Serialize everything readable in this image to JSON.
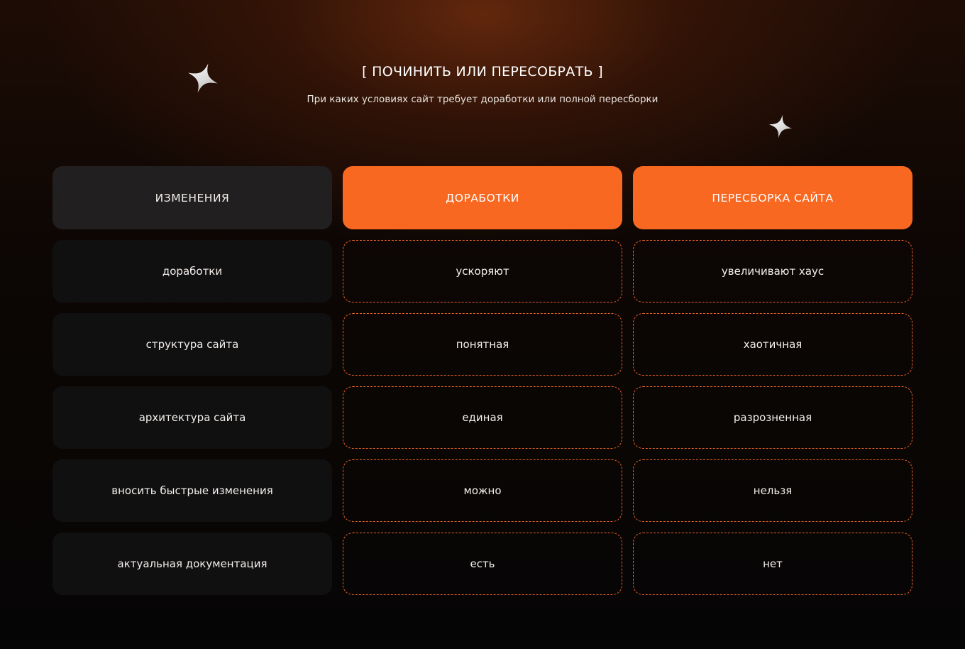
{
  "heading": "[ ПОЧИНИТЬ ИЛИ ПЕРЕСОБРАТЬ ]",
  "subheading": "При каких условиях сайт требует доработки или полной пересборки",
  "decor": {
    "star_icon": "four-point-star-icon",
    "accent_color": "#f86821"
  },
  "table": {
    "headers": [
      "ИЗМЕНЕНИЯ",
      "ДОРАБОТКИ",
      "ПЕРЕСБОРКА САЙТА"
    ],
    "rows": [
      [
        "доработки",
        "ускоряют",
        "увеличивают хаус"
      ],
      [
        "структура сайта",
        "понятная",
        "хаотичная"
      ],
      [
        "архитектура сайта",
        "единая",
        "разрозненная"
      ],
      [
        "вносить быстрые изменения",
        "можно",
        "нельзя"
      ],
      [
        "актуальная документация",
        "есть",
        "нет"
      ]
    ]
  }
}
